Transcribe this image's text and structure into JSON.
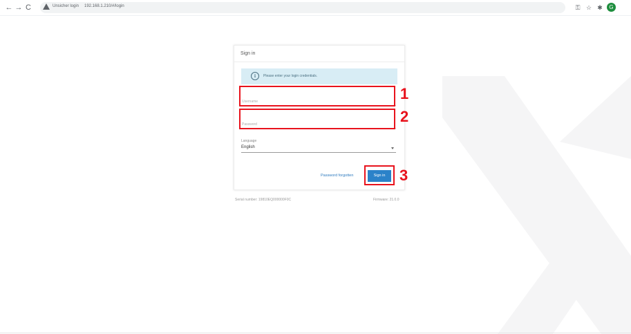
{
  "browser": {
    "back": "←",
    "forward": "→",
    "reload": "C",
    "insecure_label": "Unsicher login",
    "url": "192.168.1.210/#/login",
    "key_icon": "key-icon",
    "star_icon": "star-icon",
    "extensions_icon": "puzzle-icon",
    "profile_initial": "G"
  },
  "card": {
    "title": "Sign in",
    "info_icon": "i",
    "info_text": "Please enter your login credentials.",
    "username_placeholder": "Username",
    "password_placeholder": "Password",
    "language_label": "Language",
    "language_value": "English",
    "password_forgotten": "Password forgotten",
    "signin_label": "Sign in"
  },
  "annotations": {
    "step1": "1",
    "step2": "2",
    "step3": "3",
    "color": "#e8121c"
  },
  "footer": {
    "serial": "Serial number: 19810EQ000000F0C",
    "firmware": "Firmware: 21.0.0"
  },
  "colors": {
    "accent": "#2b82c9",
    "info_bg": "#d8edf5",
    "annotation": "#e8121c"
  }
}
